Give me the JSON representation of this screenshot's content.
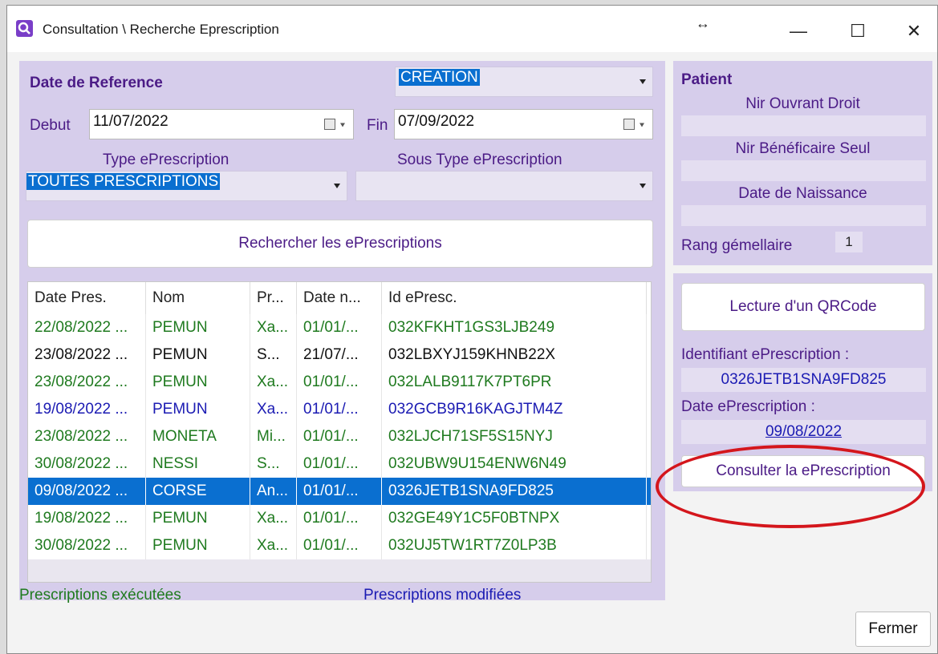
{
  "window": {
    "title": "Consultation \\ Recherche Eprescription",
    "controls": {
      "resize": "↔",
      "minimize": "—",
      "maximize": "☐",
      "close": "✕"
    }
  },
  "search": {
    "date_ref_label": "Date de Reference",
    "date_type_value": "CREATION",
    "debut_label": "Debut",
    "debut_value": "11/07/2022",
    "fin_label": "Fin",
    "fin_value": "07/09/2022",
    "type_label": "Type ePrescription",
    "type_value": "TOUTES PRESCRIPTIONS",
    "sous_type_label": "Sous Type ePrescription",
    "sous_type_value": "",
    "search_button": "Rechercher les ePrescriptions"
  },
  "table": {
    "headers": [
      "Date Pres.",
      "Nom",
      "Pr...",
      "Date n...",
      "Id ePresc."
    ],
    "rows": [
      {
        "cells": [
          "22/08/2022 ...",
          "PEMUN",
          "Xa...",
          "01/01/...",
          "032KFKHT1GS3LJB249"
        ],
        "color": "green"
      },
      {
        "cells": [
          "23/08/2022 ...",
          "PEMUN",
          "S...",
          "21/07/...",
          "032LBXYJ159KHNB22X"
        ],
        "color": "black"
      },
      {
        "cells": [
          "23/08/2022 ...",
          "PEMUN",
          "Xa...",
          "01/01/...",
          "032LALB9117K7PT6PR"
        ],
        "color": "green"
      },
      {
        "cells": [
          "19/08/2022 ...",
          "PEMUN",
          "Xa...",
          "01/01/...",
          "032GCB9R16KAGJTM4Z"
        ],
        "color": "blue"
      },
      {
        "cells": [
          "23/08/2022 ...",
          "MONETA",
          "Mi...",
          "01/01/...",
          "032LJCH71SF5S15NYJ"
        ],
        "color": "green"
      },
      {
        "cells": [
          "30/08/2022 ...",
          "NESSI",
          "S...",
          "01/01/...",
          "032UBW9U154ENW6N49"
        ],
        "color": "green"
      },
      {
        "cells": [
          "09/08/2022 ...",
          "CORSE",
          "An...",
          "01/01/...",
          "0326JETB1SNA9FD825"
        ],
        "color": "selected"
      },
      {
        "cells": [
          "19/08/2022 ...",
          "PEMUN",
          "Xa...",
          "01/01/...",
          "032GE49Y1C5F0BTNPX"
        ],
        "color": "green"
      },
      {
        "cells": [
          "30/08/2022 ...",
          "PEMUN",
          "Xa...",
          "01/01/...",
          "032UJ5TW1RT7Z0LP3B"
        ],
        "color": "green"
      }
    ]
  },
  "legend": {
    "executed": "Prescriptions exécutées",
    "modified": "Prescriptions modifiées"
  },
  "patient": {
    "title": "Patient",
    "nir_ouvrant_label": "Nir Ouvrant Droit",
    "nir_ouvrant_value": "",
    "nir_benef_label": "Nir Bénéficaire Seul",
    "nir_benef_value": "",
    "naissance_label": "Date de Naissance",
    "naissance_value": "",
    "rang_label": "Rang gémellaire",
    "rang_value": "1"
  },
  "qr": {
    "read_button": "Lecture d'un QRCode",
    "id_label": "Identifiant ePrescription :",
    "id_value": "0326JETB1SNA9FD825",
    "date_label": "Date ePrescription :",
    "date_value": "09/08/2022",
    "consult_button": "Consulter la ePrescription"
  },
  "footer": {
    "close_button": "Fermer"
  },
  "colors": {
    "panel": "#d6cdeb",
    "accent_purple": "#4b1b86",
    "selection_blue": "#0a6fd0",
    "executed_green": "#1f7a1f",
    "modified_blue": "#1b1bb3",
    "annotation_red": "#d4161c"
  }
}
